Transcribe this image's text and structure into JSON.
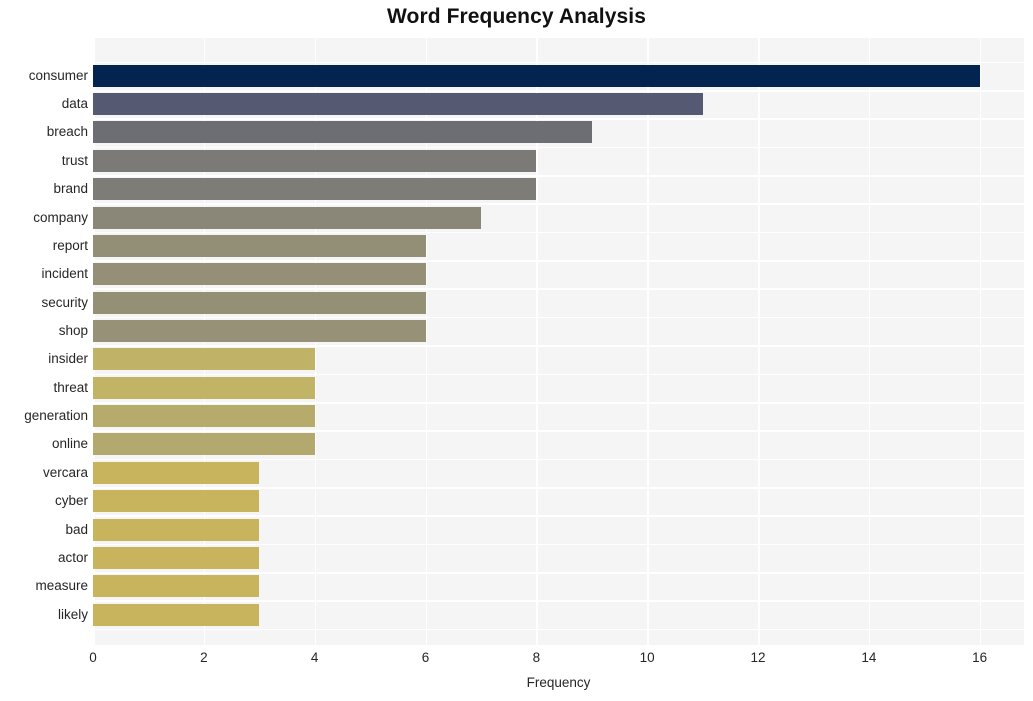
{
  "chart_data": {
    "type": "bar",
    "orientation": "horizontal",
    "title": "Word Frequency Analysis",
    "xlabel": "Frequency",
    "ylabel": "",
    "xlim": [
      0,
      16.8
    ],
    "xticks": [
      0,
      2,
      4,
      6,
      8,
      10,
      12,
      14,
      16
    ],
    "xtick_labels": [
      "0",
      "2",
      "4",
      "6",
      "8",
      "10",
      "12",
      "14",
      "16"
    ],
    "grid": true,
    "legend": "none",
    "categories": [
      "consumer",
      "data",
      "breach",
      "trust",
      "brand",
      "company",
      "report",
      "incident",
      "security",
      "shop",
      "insider",
      "threat",
      "generation",
      "online",
      "vercara",
      "cyber",
      "bad",
      "actor",
      "measure",
      "likely"
    ],
    "values": [
      16,
      11,
      9,
      8,
      8,
      7,
      6,
      6,
      6,
      6,
      4,
      4,
      4,
      4,
      3,
      3,
      3,
      3,
      3,
      3
    ],
    "bar_colors": [
      "#042450",
      "#555a72",
      "#6c6e74",
      "#7b7a76",
      "#7d7c76",
      "#8a8779",
      "#938f77",
      "#948f76",
      "#949076",
      "#969177",
      "#c0b367",
      "#c1b466",
      "#b6ab6b",
      "#b3a86d",
      "#c9b45e",
      "#c9b45e",
      "#c9b45e",
      "#c9b45e",
      "#c9b45e",
      "#c9b45e"
    ],
    "plot_background": "#f5f5f5",
    "gridline_color": "#ffffff",
    "figure_background": "#ffffff",
    "text_color": "#262626"
  }
}
